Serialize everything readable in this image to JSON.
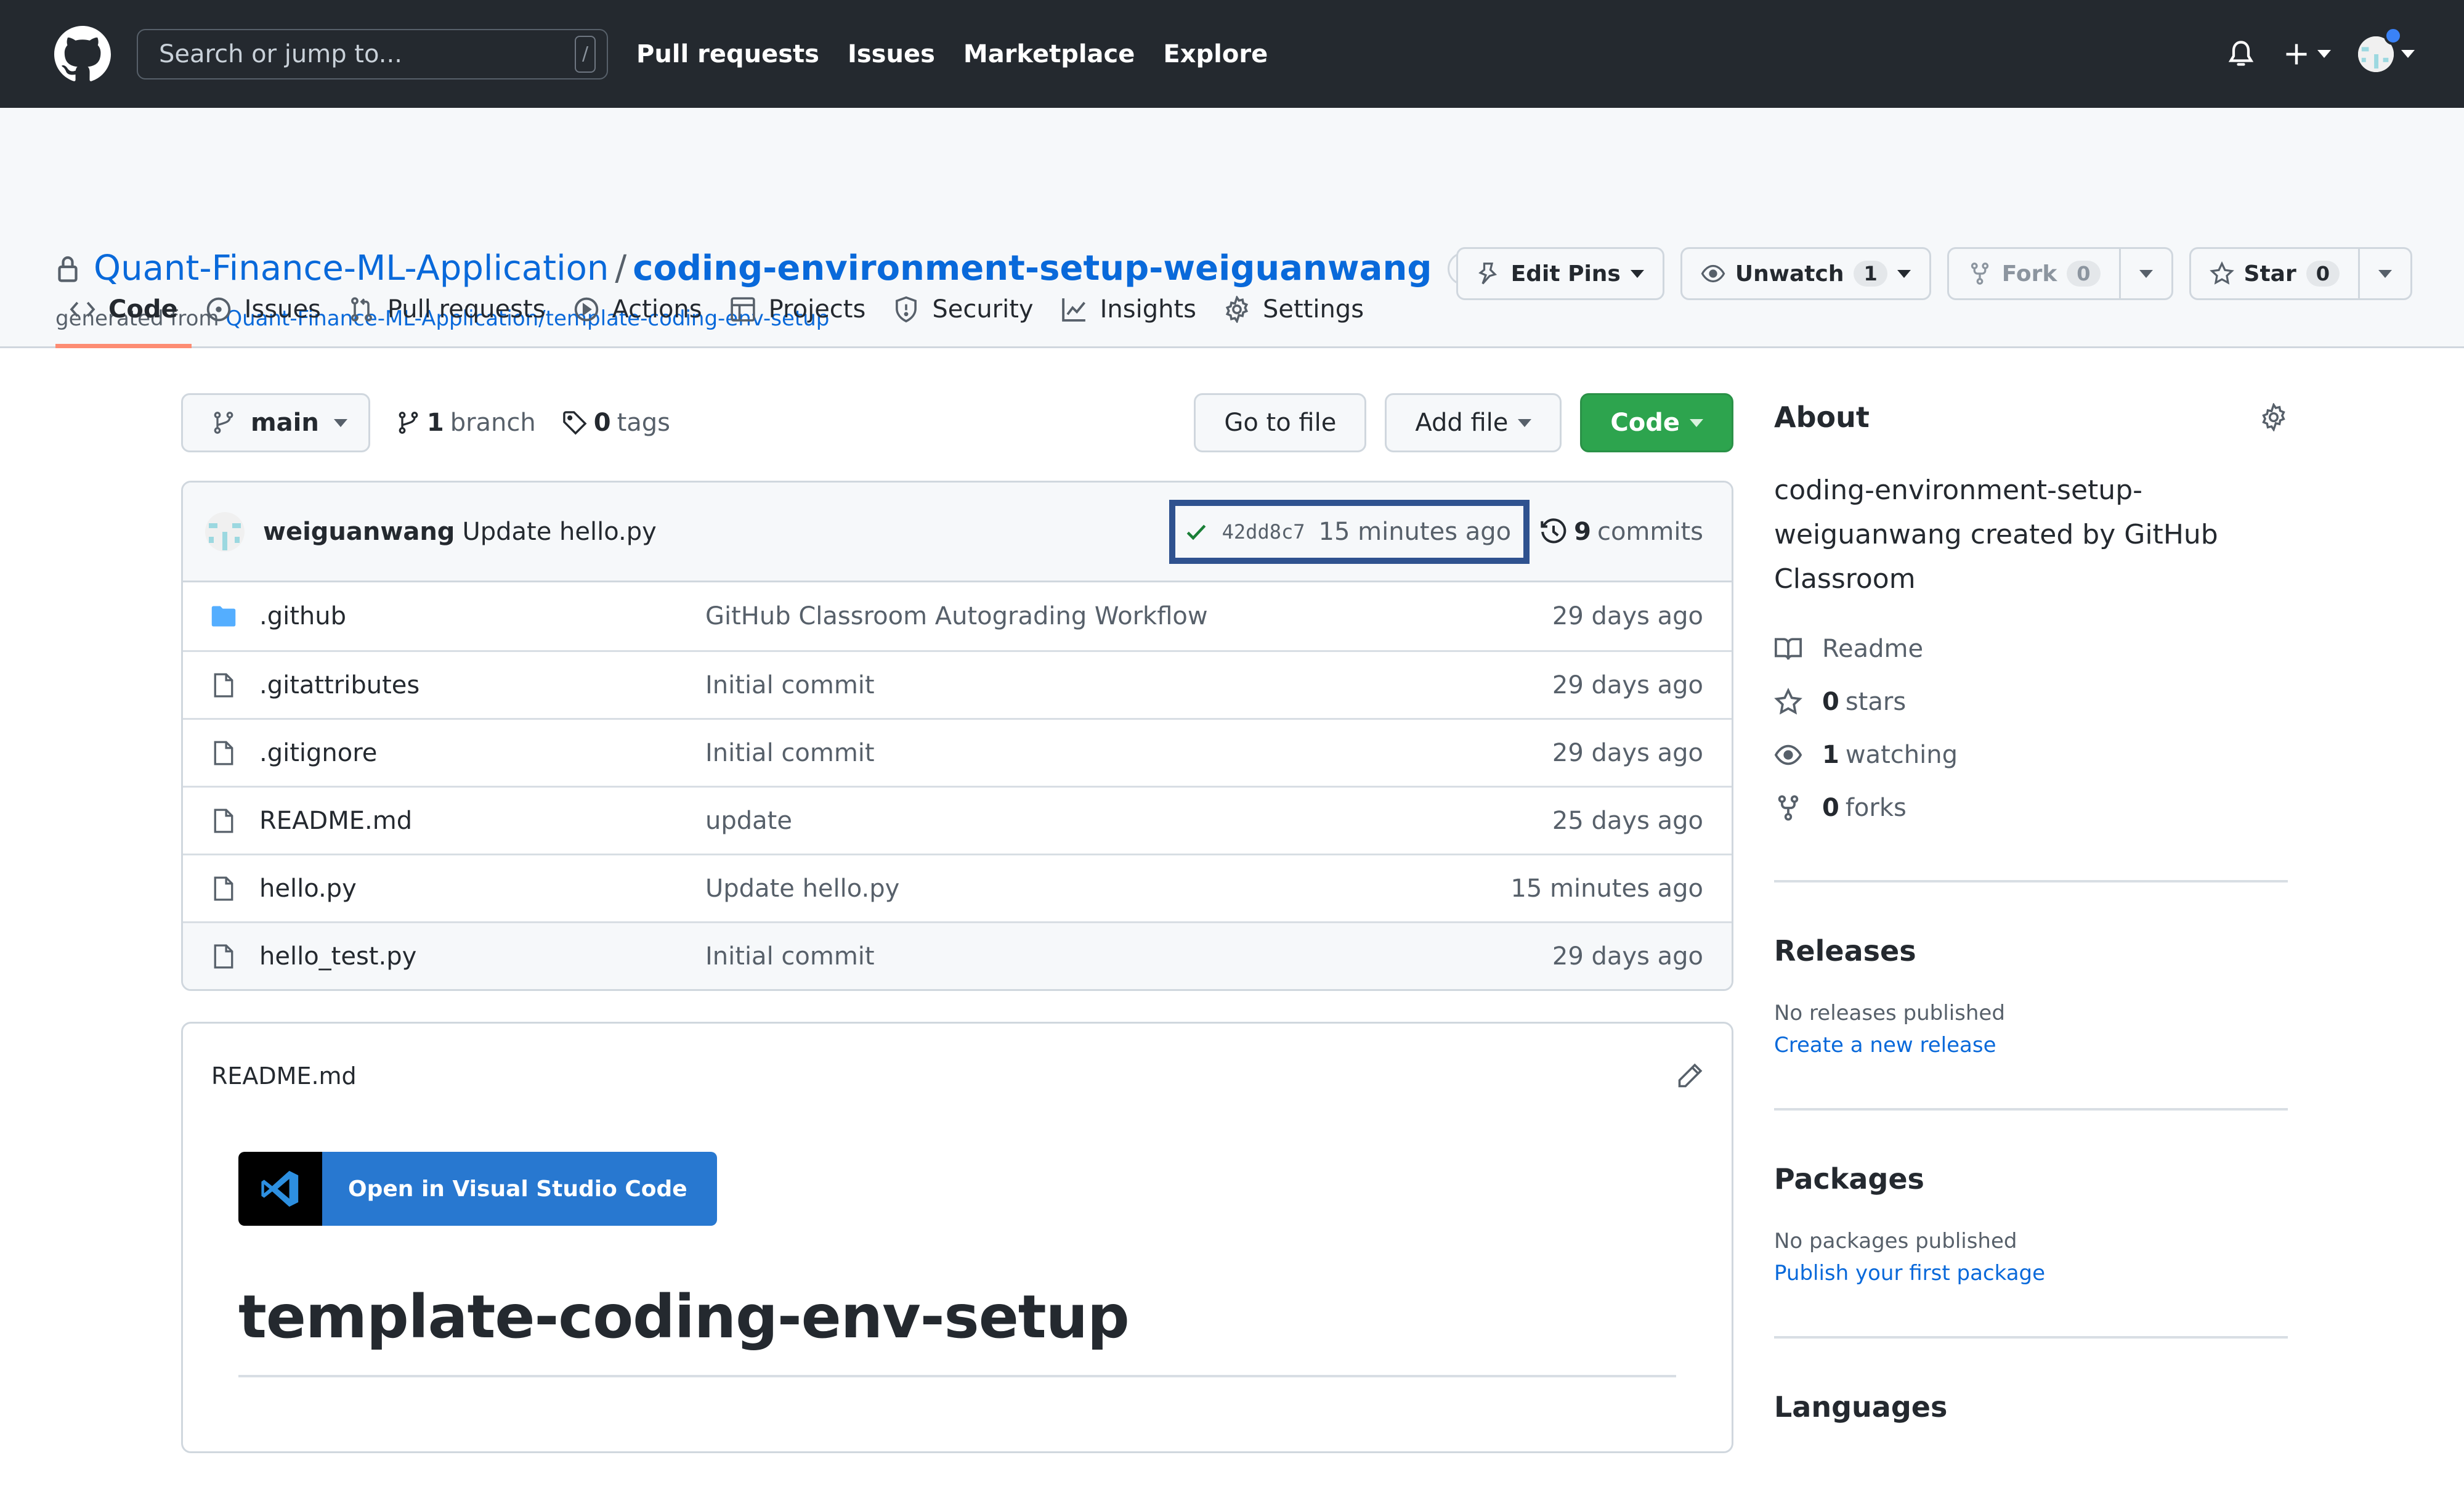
{
  "header": {
    "search_placeholder": "Search or jump to...",
    "search_shortcut": "/",
    "nav": [
      "Pull requests",
      "Issues",
      "Marketplace",
      "Explore"
    ],
    "icons": [
      "github-logo-icon",
      "bell-icon",
      "plus-icon",
      "avatar"
    ]
  },
  "repo": {
    "owner": "Quant-Finance-ML-Application",
    "separator": "/",
    "name": "coding-environment-setup-weiguanwang",
    "visibility": "Private",
    "generated_prefix": "generated from",
    "generated_from": "Quant-Finance-ML-Application/template-coding-env-setup",
    "actions": {
      "edit_pins": "Edit Pins",
      "unwatch": "Unwatch",
      "watch_count": "1",
      "fork": "Fork",
      "fork_count": "0",
      "star": "Star",
      "star_count": "0"
    },
    "tabs": [
      {
        "label": "Code",
        "icon": "code-icon",
        "active": true
      },
      {
        "label": "Issues",
        "icon": "issue-icon"
      },
      {
        "label": "Pull requests",
        "icon": "pull-request-icon"
      },
      {
        "label": "Actions",
        "icon": "play-icon"
      },
      {
        "label": "Projects",
        "icon": "table-icon"
      },
      {
        "label": "Security",
        "icon": "shield-icon"
      },
      {
        "label": "Insights",
        "icon": "graph-icon"
      },
      {
        "label": "Settings",
        "icon": "gear-icon"
      }
    ]
  },
  "file_nav": {
    "branch": "main",
    "branch_count": "1",
    "branch_label": "branch",
    "tag_count": "0",
    "tag_label": "tags",
    "go_to_file": "Go to file",
    "add_file": "Add file",
    "code": "Code"
  },
  "latest_commit": {
    "author": "weiguanwang",
    "message": "Update hello.py",
    "status": "success",
    "sha": "42dd8c7",
    "time": "15 minutes ago",
    "commit_count": "9",
    "commits_label": "commits"
  },
  "files": [
    {
      "name": ".github",
      "type": "folder",
      "message": "GitHub Classroom Autograding Workflow",
      "date": "29 days ago"
    },
    {
      "name": ".gitattributes",
      "type": "file",
      "message": "Initial commit",
      "date": "29 days ago"
    },
    {
      "name": ".gitignore",
      "type": "file",
      "message": "Initial commit",
      "date": "29 days ago"
    },
    {
      "name": "README.md",
      "type": "file",
      "message": "update",
      "date": "25 days ago"
    },
    {
      "name": "hello.py",
      "type": "file",
      "message": "Update hello.py",
      "date": "15 minutes ago"
    },
    {
      "name": "hello_test.py",
      "type": "file",
      "message": "Initial commit",
      "date": "29 days ago"
    }
  ],
  "readme": {
    "filename": "README.md",
    "badge_label": "Open in Visual Studio Code",
    "heading": "template-coding-env-setup"
  },
  "sidebar": {
    "about_title": "About",
    "description": "coding-environment-setup-weiguanwang created by GitHub Classroom",
    "readme": "Readme",
    "stars_count": "0",
    "stars_label": "stars",
    "watching_count": "1",
    "watching_label": "watching",
    "forks_count": "0",
    "forks_label": "forks",
    "releases_title": "Releases",
    "releases_empty": "No releases published",
    "releases_link": "Create a new release",
    "packages_title": "Packages",
    "packages_empty": "No packages published",
    "packages_link": "Publish your first package",
    "languages_title": "Languages"
  },
  "colors": {
    "header_bg": "#24292f",
    "link": "#0969da",
    "primary_button": "#2da44e",
    "active_tab_underline": "#fd8c73",
    "highlight_box": "#2f528f",
    "folder": "#54aeff",
    "vscode_badge": "#2878d0"
  }
}
